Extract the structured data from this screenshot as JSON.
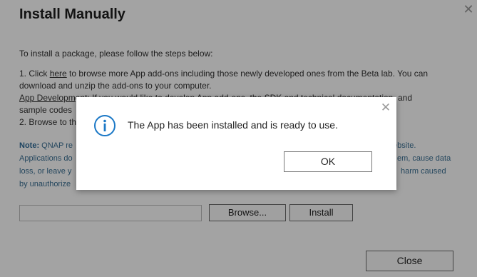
{
  "dialog": {
    "title": "Install Manually",
    "intro": "To install a package, please follow the steps below:",
    "step1_prefix": "1. Click ",
    "step1_link": "here",
    "step1_suffix": " to browse more App add-ons including those newly developed ones from the Beta lab. You can download and unzip the add-ons to your computer.",
    "step1_extra_link": "App Developm",
    "step1_extra_visible": "ent: If you would like to develop App add-ons, the SDK and technical documentation, and",
    "step1_extra_line2": "sample codes",
    "step2": "2. Browse to th",
    "note_label": "Note:",
    "note_line1_start": " QNAP re",
    "note_line1_end": "ebsite.",
    "note_line2_start": "Applications do",
    "note_line2_end": "em, cause data",
    "note_line3_start": "loss, or leave y",
    "note_line3_end": "harm caused",
    "note_line4_start": "by unauthorize",
    "browse_label": "Browse...",
    "install_label": "Install",
    "close_label": "Close"
  },
  "modal": {
    "message": "The App has been installed and is ready to use.",
    "ok_label": "OK",
    "icon": "info-icon"
  },
  "colors": {
    "note_text": "#3a6f93",
    "info_icon": "#1b78c6",
    "overlay": "rgba(0,0,0,0.36)"
  }
}
